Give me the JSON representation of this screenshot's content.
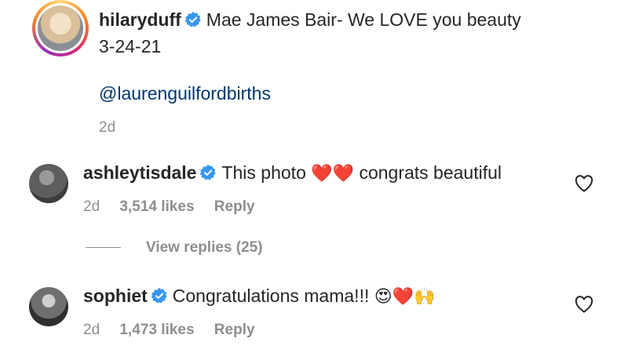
{
  "caption": {
    "username": "hilaryduff",
    "text": "Mae James Bair- We LOVE you beauty 3-24-21",
    "mention": "@laurenguilfordbirths",
    "time": "2d"
  },
  "comments": [
    {
      "username": "ashleytisdale",
      "text_before": "This photo",
      "emoji": "❤️❤️",
      "text_after": "congrats beautiful",
      "time": "2d",
      "likes": "3,514 likes",
      "reply": "Reply"
    },
    {
      "username": "sophiet",
      "text_before": "Congratulations mama!!!",
      "emoji": "😍❤️🙌",
      "text_after": "",
      "time": "2d",
      "likes": "1,473 likes",
      "reply": "Reply"
    }
  ],
  "view_replies": "View replies (25)",
  "colors": {
    "verified": "#3897f0",
    "text": "#262626",
    "muted": "#8e8e8e",
    "link": "#00376b",
    "heart": "#ed4956"
  }
}
